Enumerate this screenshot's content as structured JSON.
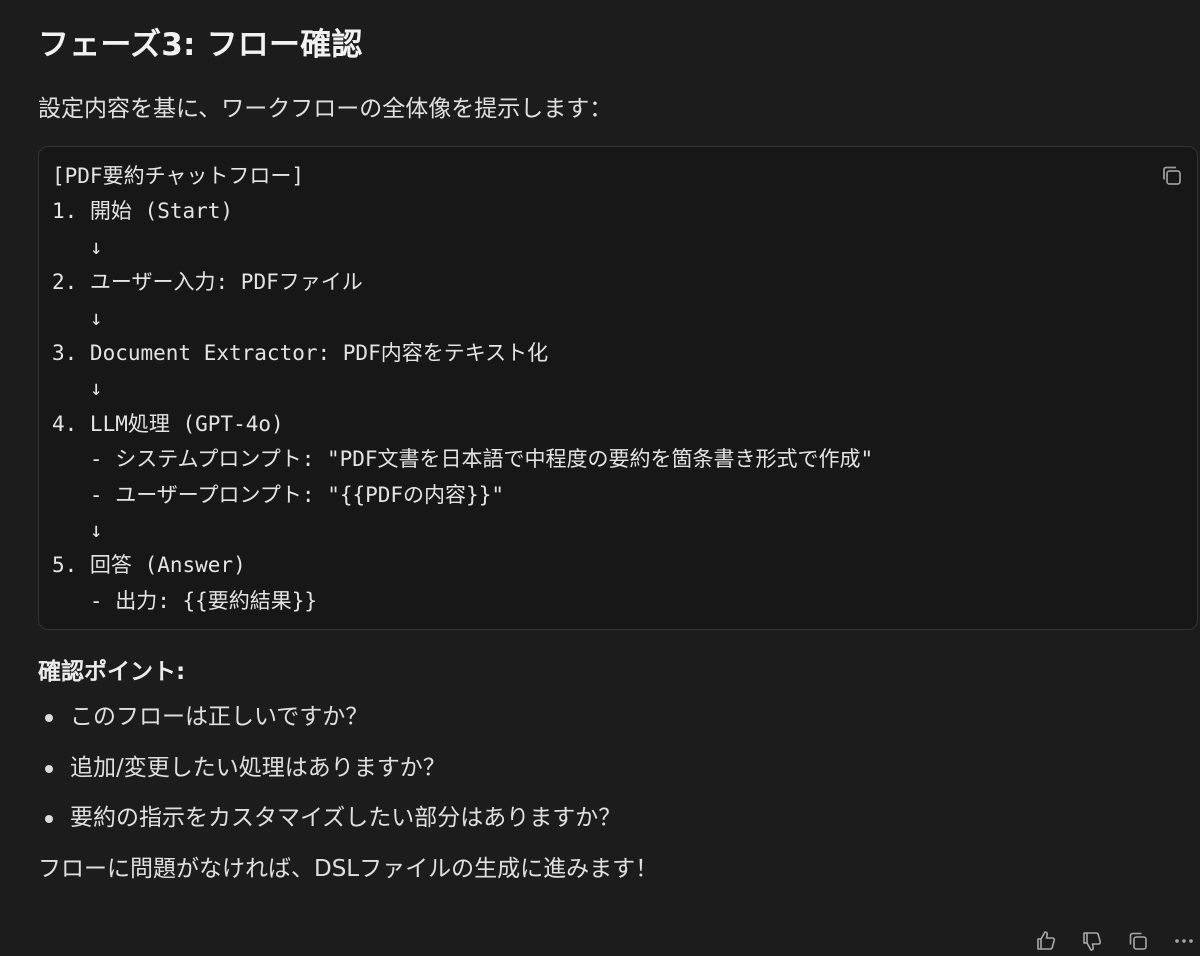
{
  "message": {
    "heading": "フェーズ3: フロー確認",
    "intro": "設定内容を基に、ワークフローの全体像を提示します：",
    "code_lines": [
      "[PDF要約チャットフロー]",
      "1. 開始 (Start)",
      "   ↓",
      "2. ユーザー入力: PDFファイル",
      "   ↓",
      "3. Document Extractor: PDF内容をテキスト化",
      "   ↓",
      "4. LLM処理 (GPT-4o)",
      "   - システムプロンプト: \"PDF文書を日本語で中程度の要約を箇条書き形式で作成\"",
      "   - ユーザープロンプト: \"{{PDFの内容}}\"",
      "   ↓",
      "5. 回答 (Answer)",
      "   - 出力: {{要約結果}}"
    ],
    "subheading": "確認ポイント:",
    "points": [
      "このフローは正しいですか？",
      "追加/変更したい処理はありますか？",
      "要約の指示をカスタマイズしたい部分はありますか？"
    ],
    "closing": "フローに問題がなければ、DSLファイルの生成に進みます！"
  },
  "icons": {
    "copy": "copy-icon",
    "thumbs_up": "thumbs-up-icon",
    "thumbs_down": "thumbs-down-icon",
    "more": "more-icon"
  }
}
